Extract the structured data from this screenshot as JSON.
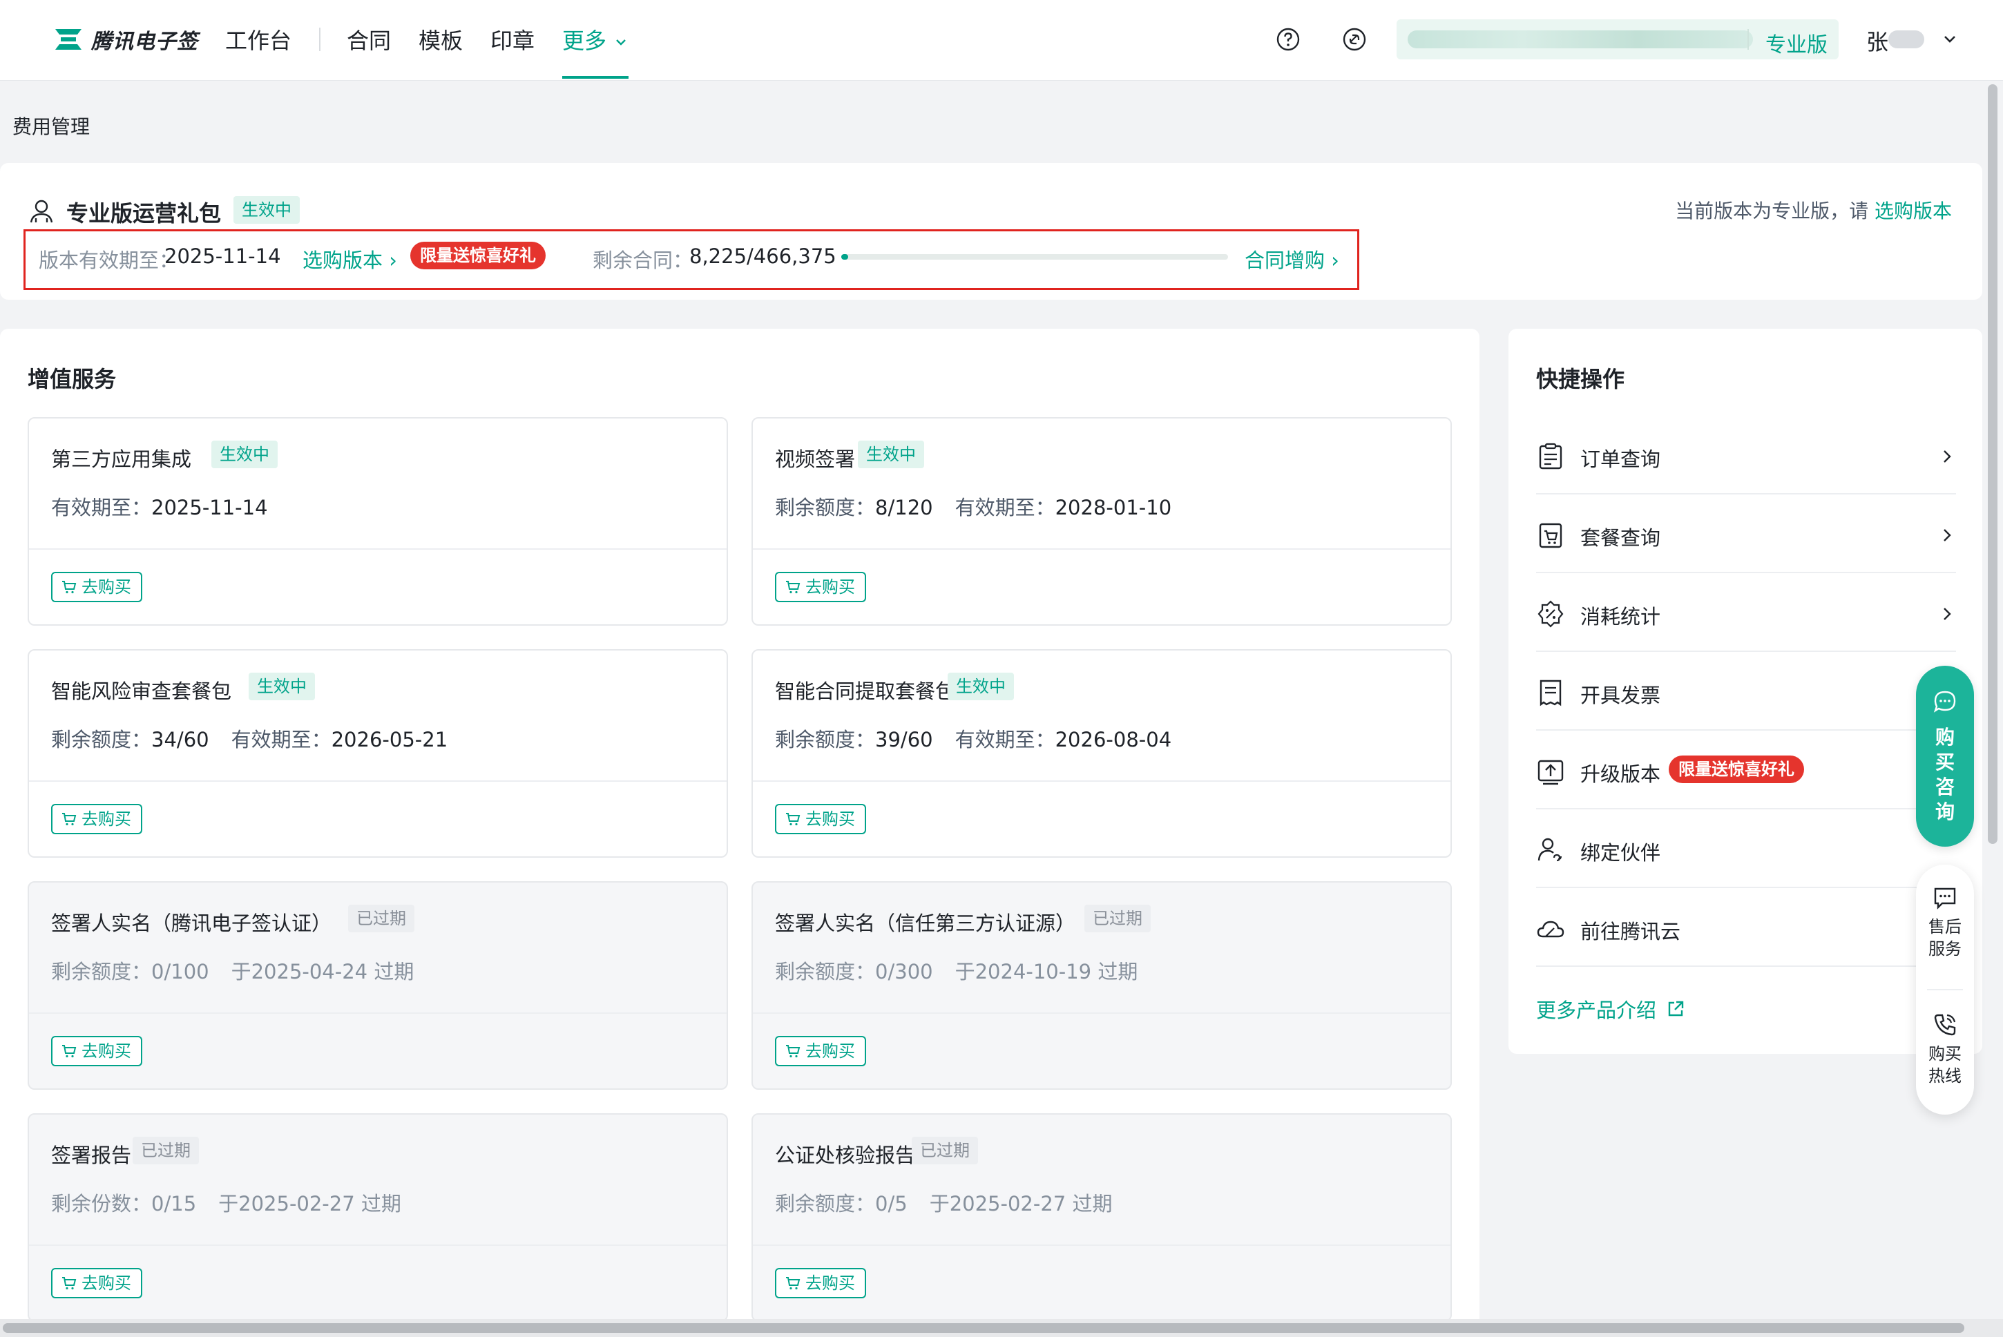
{
  "nav": {
    "brand": "腾讯电子签",
    "items": [
      {
        "label": "工作台"
      },
      {
        "label": "合同"
      },
      {
        "label": "模板"
      },
      {
        "label": "印章"
      },
      {
        "label": "更多"
      }
    ],
    "edition": "专业版",
    "user_initial": "张"
  },
  "page": {
    "breadcrumb": "费用管理"
  },
  "plan": {
    "name": "专业版运营礼包",
    "status": "生效中",
    "note_prefix": "当前版本为专业版，请",
    "note_link": "选购版本",
    "validity_label": "版本有效期至：",
    "validity_value": "2025-11-14",
    "select_version": "选购版本 ›",
    "promo": "限量送惊喜好礼",
    "remaining_label": "剩余合同：",
    "remaining_value": "8,225/466,375",
    "remaining_ratio": 0.0176,
    "add_contracts": "合同增购 ›"
  },
  "services": {
    "title": "增值服务",
    "buy_label": "去购买",
    "items": [
      {
        "title": "第三方应用集成",
        "status": "生效中",
        "expired": false,
        "detail_label": "有效期至：",
        "detail_value": "2025-11-14"
      },
      {
        "title": "视频签署",
        "status": "生效中",
        "expired": false,
        "detail_label": "剩余额度：",
        "detail_value": "8/120",
        "detail2_label": "有效期至：",
        "detail2_value": "2028-01-10"
      },
      {
        "title": "智能风险审查套餐包",
        "status": "生效中",
        "expired": false,
        "detail_label": "剩余额度：",
        "detail_value": "34/60",
        "detail2_label": "有效期至：",
        "detail2_value": "2026-05-21"
      },
      {
        "title": "智能合同提取套餐包",
        "status": "生效中",
        "expired": false,
        "detail_label": "剩余额度：",
        "detail_value": "39/60",
        "detail2_label": "有效期至：",
        "detail2_value": "2026-08-04"
      },
      {
        "title": "签署人实名（腾讯电子签认证）",
        "status": "已过期",
        "expired": true,
        "detail_label": "剩余额度：",
        "detail_value": "0/100",
        "detail2_label": "",
        "detail2_value": "于2025-04-24 过期"
      },
      {
        "title": "签署人实名（信任第三方认证源）",
        "status": "已过期",
        "expired": true,
        "detail_label": "剩余额度：",
        "detail_value": "0/300",
        "detail2_label": "",
        "detail2_value": "于2024-10-19 过期"
      },
      {
        "title": "签署报告",
        "status": "已过期",
        "expired": true,
        "detail_label": "剩余份数：",
        "detail_value": "0/15",
        "detail2_label": "",
        "detail2_value": "于2025-02-27 过期"
      },
      {
        "title": "公证处核验报告",
        "status": "已过期",
        "expired": true,
        "detail_label": "剩余额度：",
        "detail_value": "0/5",
        "detail2_label": "",
        "detail2_value": "于2025-02-27 过期"
      }
    ]
  },
  "quick": {
    "title": "快捷操作",
    "items": [
      {
        "label": "订单查询",
        "icon": "order-icon"
      },
      {
        "label": "套餐查询",
        "icon": "package-icon"
      },
      {
        "label": "消耗统计",
        "icon": "statistics-icon"
      },
      {
        "label": "开具发票",
        "icon": "invoice-icon"
      },
      {
        "label": "升级版本",
        "icon": "upgrade-icon",
        "promo": "限量送惊喜好礼"
      },
      {
        "label": "绑定伙伴",
        "icon": "partner-icon"
      },
      {
        "label": "前往腾讯云",
        "icon": "cloud-icon"
      }
    ],
    "more": "更多产品介绍"
  },
  "float": {
    "consult": "购买咨询",
    "service_line1": "售后",
    "service_line2": "服务",
    "hotline_line1": "购买",
    "hotline_line2": "热线"
  },
  "colors": {
    "accent": "#00a38a",
    "promo": "#e5342d",
    "highlight_border": "#e0241f"
  }
}
